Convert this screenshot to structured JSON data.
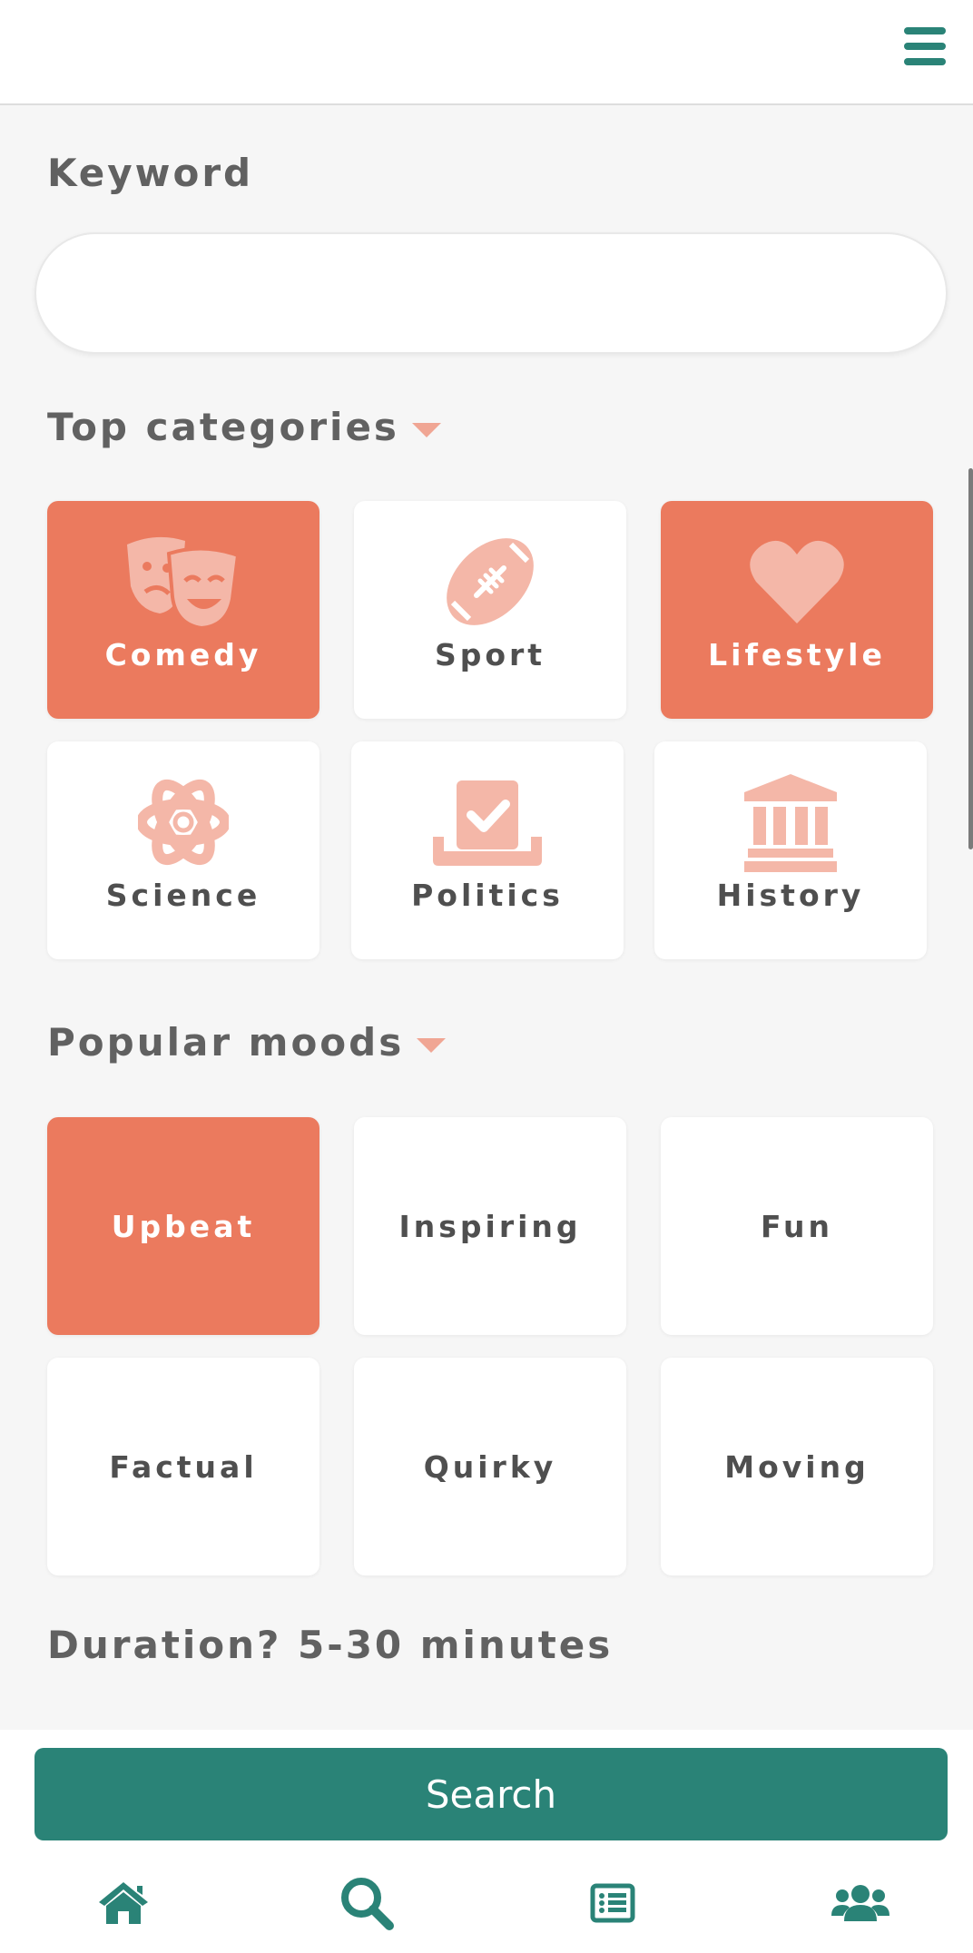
{
  "keyword": {
    "label": "Keyword",
    "value": "",
    "placeholder": ""
  },
  "categories": {
    "title": "Top categories",
    "items": [
      {
        "label": "Comedy",
        "icon": "theater-masks-icon",
        "selected": true
      },
      {
        "label": "Sport",
        "icon": "football-icon",
        "selected": false
      },
      {
        "label": "Lifestyle",
        "icon": "heart-icon",
        "selected": true
      },
      {
        "label": "Science",
        "icon": "atom-icon",
        "selected": false
      },
      {
        "label": "Politics",
        "icon": "ballot-box-icon",
        "selected": false
      },
      {
        "label": "History",
        "icon": "landmark-icon",
        "selected": false
      }
    ]
  },
  "moods": {
    "title": "Popular moods",
    "items": [
      {
        "label": "Upbeat",
        "selected": true
      },
      {
        "label": "Inspiring",
        "selected": false
      },
      {
        "label": "Fun",
        "selected": false
      },
      {
        "label": "Factual",
        "selected": false
      },
      {
        "label": "Quirky",
        "selected": false
      },
      {
        "label": "Moving",
        "selected": false
      }
    ]
  },
  "duration": {
    "label": "Duration? 5-30 minutes"
  },
  "search_button": {
    "label": "Search"
  },
  "bottom_nav": [
    {
      "name": "home",
      "icon": "home-icon",
      "active": false
    },
    {
      "name": "search",
      "icon": "search-icon",
      "active": true
    },
    {
      "name": "list",
      "icon": "list-icon",
      "active": false
    },
    {
      "name": "community",
      "icon": "users-icon",
      "active": false
    }
  ],
  "colors": {
    "accent": "#eb7a5e",
    "accent_light": "#f4b7a8",
    "primary": "#2a8377",
    "text": "#5a5a5a",
    "background": "#f6f6f6"
  }
}
